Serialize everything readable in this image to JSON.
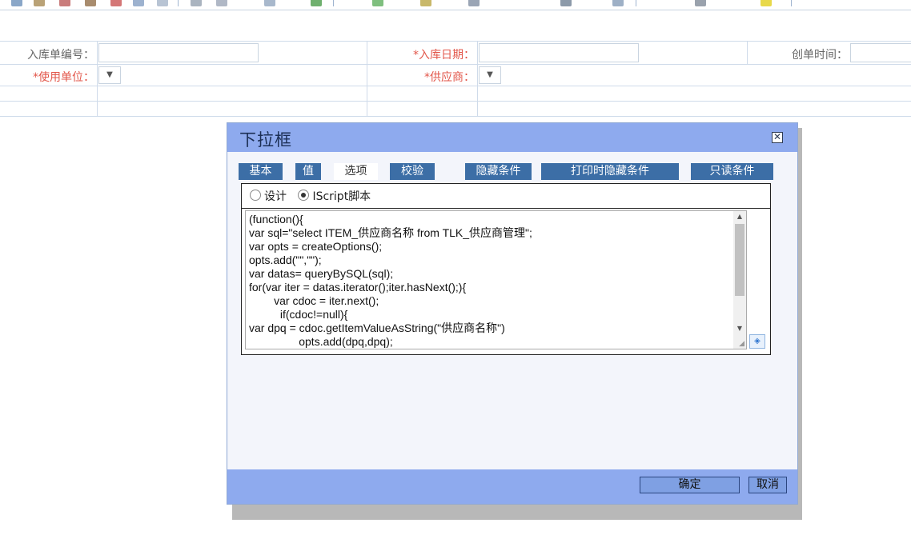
{
  "toolbar": {
    "icons": [
      "save-icon",
      "print-icon",
      "cut-icon",
      "insert-icon",
      "field-icon",
      "run-icon",
      "table-icon",
      "row-icon",
      "column-icon",
      "chart-icon",
      "grid-icon",
      "image-icon",
      "tree-icon",
      "calendar-icon",
      "user-icon",
      "link-icon",
      "settings-icon"
    ]
  },
  "form": {
    "row1": {
      "label1": "入库单编号：",
      "label2": "*入库日期：",
      "label3": "创单时间："
    },
    "row2": {
      "label1": "*使用单位：",
      "label2": "*供应商：",
      "select_arrow": "▼"
    }
  },
  "dialog": {
    "title": "下拉框",
    "close_glyph": "✕",
    "tabs": [
      "基本",
      "值",
      "选项",
      "校验",
      "隐藏条件",
      "打印时隐藏条件",
      "只读条件"
    ],
    "active_tab": "选项",
    "radio_options": [
      "设计",
      "IScript脚本"
    ],
    "radio_selected": "IScript脚本",
    "code": "(function(){\nvar sql=\"select ITEM_供应商名称 from TLK_供应商管理\";\nvar opts = createOptions();\nopts.add(\"\",\"\");\nvar datas= queryBySQL(sql);\nfor(var iter = datas.iterator();iter.hasNext();){\n        var cdoc = iter.next();\n          if(cdoc!=null){\nvar dpq = cdoc.getItemValueAsString(\"供应商名称\")\n                opts.add(dpq,dpq);",
    "confirm_label": "确定",
    "cancel_label": "取消"
  },
  "colors": {
    "dialog_header": "#8eaaee",
    "tab_bg": "#3c6ea6",
    "required_label": "#e2564a"
  }
}
